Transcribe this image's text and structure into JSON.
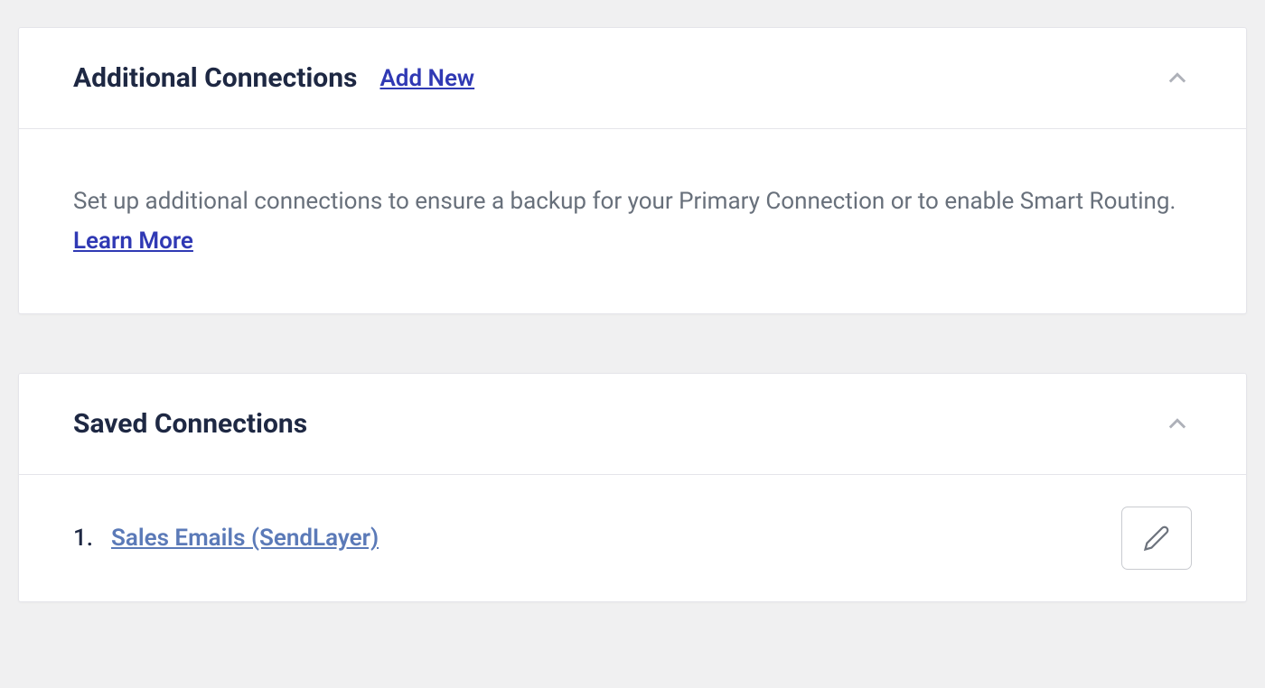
{
  "panels": {
    "additional_connections": {
      "title": "Additional Connections",
      "add_new_label": "Add New",
      "description_prefix": "Set up additional connections to ensure a backup for your Primary Connection or to enable Smart Routing. ",
      "learn_more_label": "Learn More"
    },
    "saved_connections": {
      "title": "Saved Connections",
      "items": [
        {
          "number": "1.",
          "label": "Sales Emails (SendLayer)"
        }
      ]
    }
  }
}
